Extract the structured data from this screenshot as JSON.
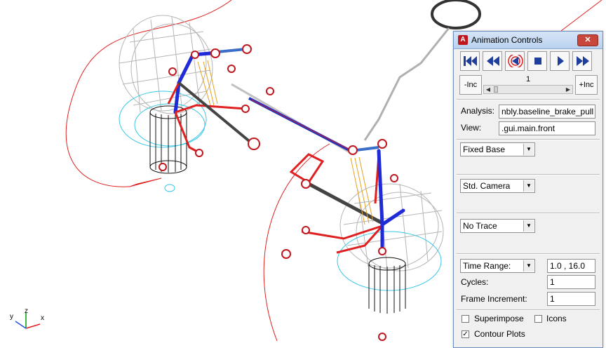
{
  "window": {
    "title": "Animation Controls",
    "app_icon_letter": "A",
    "close_glyph": "✕"
  },
  "playback": {
    "frame": "1",
    "dec_label": "-Inc",
    "inc_label": "+Inc"
  },
  "analysis": {
    "label": "Analysis:",
    "value": "nbly.baseline_brake_pull"
  },
  "view": {
    "label": "View:",
    "value": ".gui.main.front"
  },
  "base": {
    "selected": "Fixed Base"
  },
  "camera": {
    "selected": "Std. Camera"
  },
  "trace": {
    "selected": "No Trace"
  },
  "time_range": {
    "selected": "Time Range:",
    "value": "1.0 , 16.0"
  },
  "cycles": {
    "label": "Cycles:",
    "value": "1"
  },
  "frame_increment": {
    "label": "Frame Increment:",
    "value": "1"
  },
  "options": {
    "superimpose": {
      "label": "Superimpose",
      "checked": false
    },
    "icons": {
      "label": "Icons",
      "checked": false
    },
    "contour_plots": {
      "label": "Contour Plots",
      "checked": true
    }
  },
  "triad": {
    "x": "x",
    "y": "y",
    "z": "z"
  },
  "colors": {
    "accent_red": "#e02020",
    "link_blue": "#1e2bd6",
    "wire_gray": "#a0a0a0",
    "cyan": "#20c0e0",
    "titlebar": "#c6dbf3"
  }
}
